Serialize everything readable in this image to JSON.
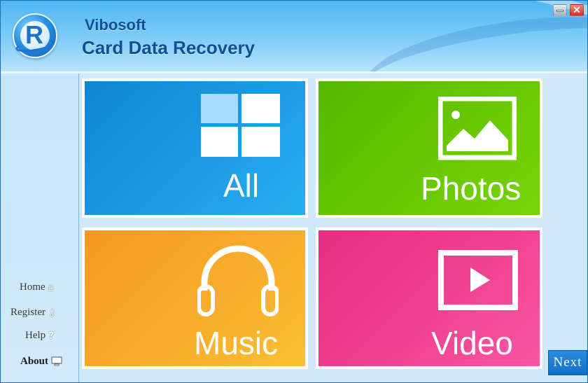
{
  "app": {
    "brand": "Vibosoft",
    "title": "Card Data Recovery",
    "logo_letter": "R"
  },
  "window_controls": {
    "minimize_icon": "minimize-icon",
    "close_icon": "close-icon",
    "close_glyph": "✕"
  },
  "sidebar": {
    "items": [
      {
        "label": "Home",
        "icon": "home-icon",
        "glyph": "⌂"
      },
      {
        "label": "Register",
        "icon": "key-icon",
        "glyph": "⚷"
      },
      {
        "label": "Help",
        "icon": "question-icon",
        "glyph": "?"
      },
      {
        "label": "About",
        "icon": "monitor-icon",
        "glyph": "▬"
      }
    ]
  },
  "tiles": {
    "all": {
      "label": "All",
      "icon": "windows-icon",
      "color": "#1b98e4"
    },
    "photos": {
      "label": "Photos",
      "icon": "image-icon",
      "color": "#66c700"
    },
    "music": {
      "label": "Music",
      "icon": "headphones-icon",
      "color": "#f8ac2b"
    },
    "video": {
      "label": "Video",
      "icon": "video-play-icon",
      "color": "#ef3f91"
    }
  },
  "footer": {
    "next_label": "Next"
  }
}
